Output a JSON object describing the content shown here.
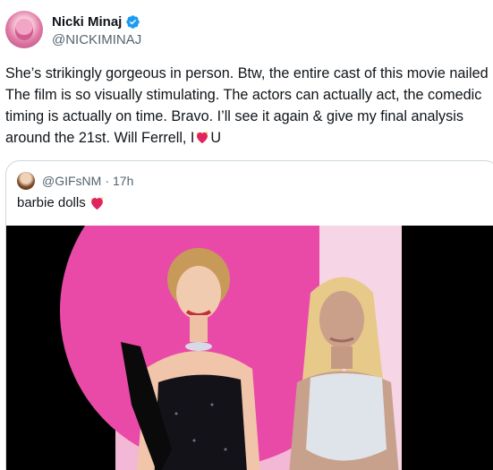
{
  "author": {
    "display_name": "Nicki Minaj",
    "handle": "@NICKIMINAJ",
    "avatar_icon": "profile-avatar",
    "verified_icon": "verified-badge-icon",
    "verified_color": "#1d9bf0"
  },
  "tweet": {
    "text_before_heart": "She’s strikingly gorgeous in person. Btw, the entire cast of this movie nailed it. The film is so visually stimulating. The actors can actually act, the comedic timing is actually on time. Bravo. I’ll see it again & give my final analysis around the 21st. Will Ferrell, I",
    "heart_icon": "sparkling-heart-emoji",
    "text_after_heart": "U"
  },
  "quoted_tweet": {
    "handle": "@GIFsNM",
    "separator": "·",
    "time": "17h",
    "text": "barbie dolls",
    "emoji_icon": "sparkling-heart-emoji",
    "media_description_icon": "barbie-photo"
  },
  "colors": {
    "text_primary": "#0f1419",
    "text_secondary": "#536471",
    "border": "#cfd9de",
    "heart": "#e0245e",
    "pink_backdrop": "#e94aa8"
  }
}
